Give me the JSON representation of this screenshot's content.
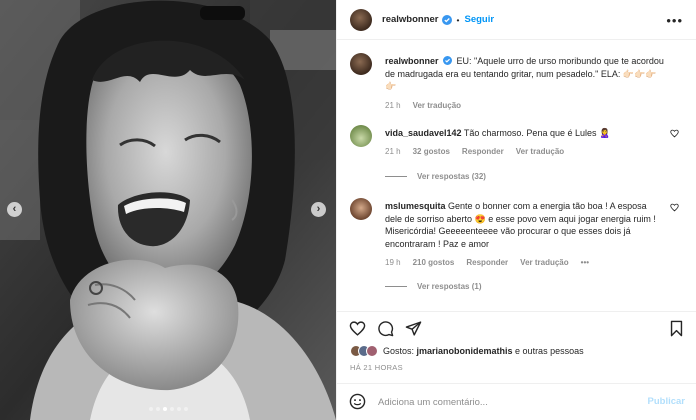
{
  "header": {
    "username": "realwbonner",
    "separator": "•",
    "follow_label": "Seguir",
    "more_icon": "more-horizontal-icon"
  },
  "caption": {
    "username": "realwbonner",
    "text": "EU: \"Aquele urro de urso moribundo que te acordou de madrugada era eu tentando gritar, num pesadelo.\" ELA: 👉🏻👉🏻👉🏻👉🏻",
    "time": "21 h",
    "translate_label": "Ver tradução"
  },
  "comments": [
    {
      "username": "vida_saudavel142",
      "text": "Tão charmoso. Pena que é Lules 🙎‍♀️",
      "time": "21 h",
      "likes": "32 gostos",
      "reply_label": "Responder",
      "translate_label": "Ver tradução",
      "replies_label": "Ver respostas (32)"
    },
    {
      "username": "mslumesquita",
      "text": "Gente o bonner com a energia tão boa ! A esposa dele de sorriso aberto 😍 e esse povo vem aqui jogar energia ruim ! Misericórdia! Geeeeenteeee vão procurar o que esses dois já encontraram ! Paz e amor",
      "time": "19 h",
      "likes": "210 gostos",
      "reply_label": "Responder",
      "translate_label": "Ver tradução",
      "more_label": "•••",
      "replies_label": "Ver respostas (1)"
    }
  ],
  "likes": {
    "prefix": "Gostos: ",
    "user": "jmarianobonidemathis",
    "suffix": " e outras pessoas"
  },
  "timestamp": "HÁ 21 HORAS",
  "add_comment": {
    "placeholder": "Adiciona um comentário...",
    "publish_label": "Publicar"
  },
  "carousel": {
    "prev_icon": "chevron-left-icon",
    "next_icon": "chevron-right-icon",
    "slide_count": 6,
    "active_index": 2
  },
  "colors": {
    "accent": "#0095f6",
    "verified": "#3897f0",
    "muted": "#8e8e8e",
    "publish_disabled": "#b2dffc"
  }
}
